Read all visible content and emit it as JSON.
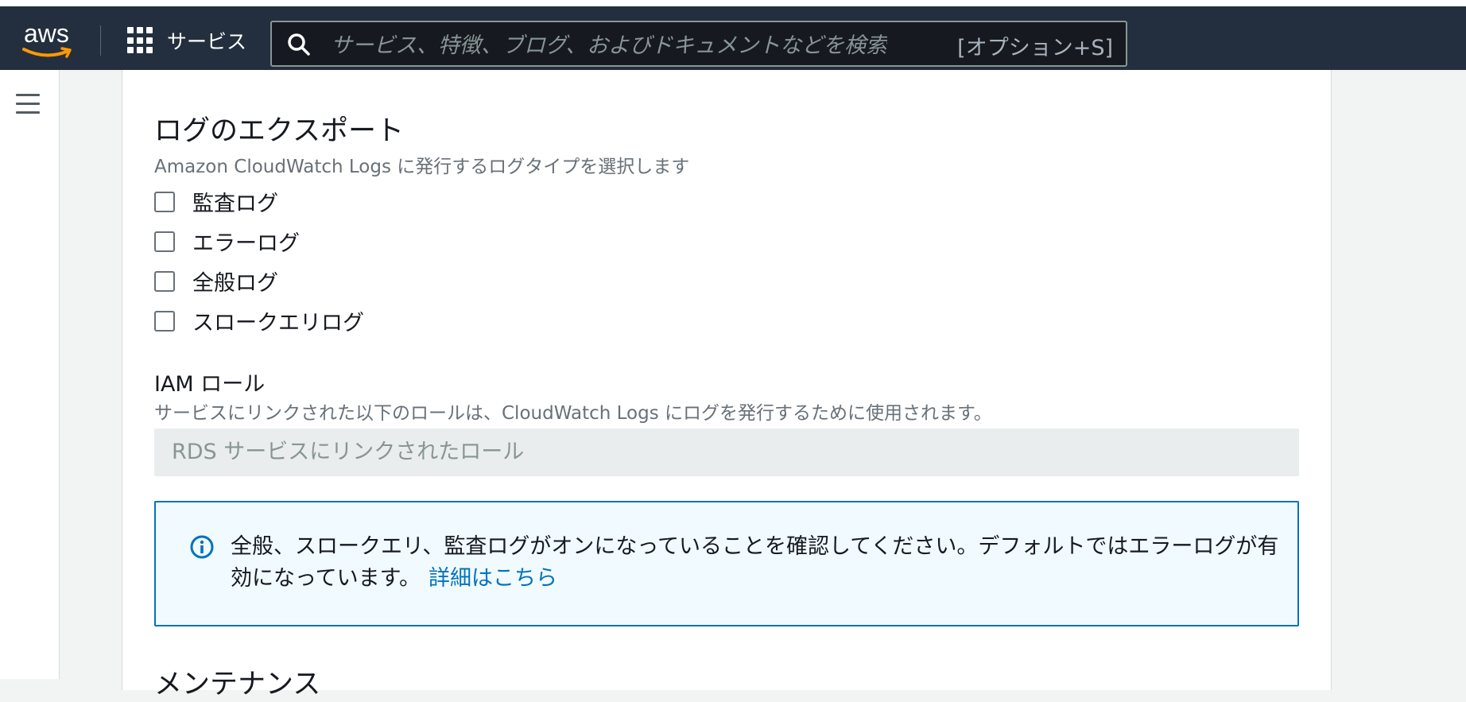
{
  "header": {
    "logo_text": "aws",
    "services_label": "サービス",
    "search": {
      "placeholder": "サービス、特徴、ブログ、およびドキュメントなどを検索",
      "shortcut": "[オプション+S]"
    }
  },
  "log_export": {
    "title": "ログのエクスポート",
    "description": "Amazon CloudWatch Logs に発行するログタイプを選択します",
    "options": [
      {
        "label": "監査ログ",
        "checked": false
      },
      {
        "label": "エラーログ",
        "checked": false
      },
      {
        "label": "全般ログ",
        "checked": false
      },
      {
        "label": "スロークエリログ",
        "checked": false
      }
    ]
  },
  "iam_role": {
    "title": "IAM ロール",
    "description": "サービスにリンクされた以下のロールは、CloudWatch Logs にログを発行するために使用されます。",
    "value": "RDS サービスにリンクされたロール"
  },
  "info_alert": {
    "text": "全般、スロークエリ、監査ログがオンになっていることを確認してください。デフォルトではエラーログが有効になっています。",
    "link": "詳細はこちら"
  },
  "next_section": {
    "title": "メンテナンス"
  },
  "colors": {
    "nav_bg": "#232f3e",
    "aws_orange": "#ff9900",
    "info_blue": "#0073bb",
    "info_bg": "#f1faff"
  },
  "icons": {
    "search": "search-icon",
    "services": "grid-icon",
    "menu": "hamburger-menu-icon",
    "info": "info-circle-icon"
  }
}
